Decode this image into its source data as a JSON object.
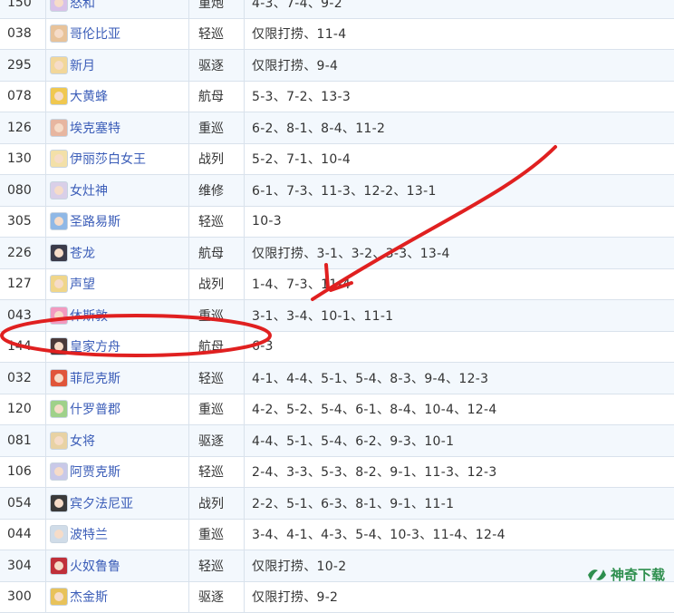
{
  "rows": [
    {
      "id": "150",
      "name": "怒和",
      "type": "重炮",
      "maps": "4-3、7-4、9-2",
      "avatar_color": "#d8c2e8"
    },
    {
      "id": "038",
      "name": "哥伦比亚",
      "type": "轻巡",
      "maps": "仅限打捞、11-4",
      "avatar_color": "#e8c39a"
    },
    {
      "id": "295",
      "name": "新月",
      "type": "驱逐",
      "maps": "仅限打捞、9-4",
      "avatar_color": "#f2d79a"
    },
    {
      "id": "078",
      "name": "大黄蜂",
      "type": "航母",
      "maps": "5-3、7-2、13-3",
      "avatar_color": "#f0c850"
    },
    {
      "id": "126",
      "name": "埃克塞特",
      "type": "重巡",
      "maps": "6-2、8-1、8-4、11-2",
      "avatar_color": "#e7b6a0"
    },
    {
      "id": "130",
      "name": "伊丽莎白女王",
      "type": "战列",
      "maps": "5-2、7-1、10-4",
      "avatar_color": "#f3e0a8"
    },
    {
      "id": "080",
      "name": "女灶神",
      "type": "维修",
      "maps": "6-1、7-3、11-3、12-2、13-1",
      "avatar_color": "#d9cfe8"
    },
    {
      "id": "305",
      "name": "圣路易斯",
      "type": "轻巡",
      "maps": "10-3",
      "avatar_color": "#8fb8e6"
    },
    {
      "id": "226",
      "name": "苍龙",
      "type": "航母",
      "maps": "仅限打捞、3-1、3-2、3-3、13-4",
      "avatar_color": "#3b3b4a"
    },
    {
      "id": "127",
      "name": "声望",
      "type": "战列",
      "maps": "1-4、7-3、11-4",
      "avatar_color": "#f0d68a"
    },
    {
      "id": "043",
      "name": "休斯敦",
      "type": "重巡",
      "maps": "3-1、3-4、10-1、11-1",
      "avatar_color": "#f29ac0"
    },
    {
      "id": "144",
      "name": "皇家方舟",
      "type": "航母",
      "maps": "6-3",
      "avatar_color": "#4a3a3a"
    },
    {
      "id": "032",
      "name": "菲尼克斯",
      "type": "轻巡",
      "maps": "4-1、4-4、5-1、5-4、8-3、9-4、12-3",
      "avatar_color": "#e0553a"
    },
    {
      "id": "120",
      "name": "什罗普郡",
      "type": "重巡",
      "maps": "4-2、5-2、5-4、6-1、8-4、10-4、12-4",
      "avatar_color": "#9fd18a"
    },
    {
      "id": "081",
      "name": "女将",
      "type": "驱逐",
      "maps": "4-4、5-1、5-4、6-2、9-3、10-1",
      "avatar_color": "#e8d2a4"
    },
    {
      "id": "106",
      "name": "阿贾克斯",
      "type": "轻巡",
      "maps": "2-4、3-3、5-3、8-2、9-1、11-3、12-3",
      "avatar_color": "#c9c9e8"
    },
    {
      "id": "054",
      "name": "宾夕法尼亚",
      "type": "战列",
      "maps": "2-2、5-1、6-3、8-1、9-1、11-1",
      "avatar_color": "#3a3a3a"
    },
    {
      "id": "044",
      "name": "波特兰",
      "type": "重巡",
      "maps": "3-4、4-1、4-3、5-4、10-3、11-4、12-4",
      "avatar_color": "#d0dce8"
    },
    {
      "id": "304",
      "name": "火奴鲁鲁",
      "type": "轻巡",
      "maps": "仅限打捞、10-2",
      "avatar_color": "#c0303a"
    },
    {
      "id": "300",
      "name": "杰金斯",
      "type": "驱逐",
      "maps": "仅限打捞、9-2",
      "avatar_color": "#e8c25a"
    }
  ],
  "annotation": {
    "highlighted_row": "144",
    "arrow_color": "#e02020"
  },
  "watermark": {
    "text": "神奇下载",
    "color": "#2e8f4e"
  }
}
